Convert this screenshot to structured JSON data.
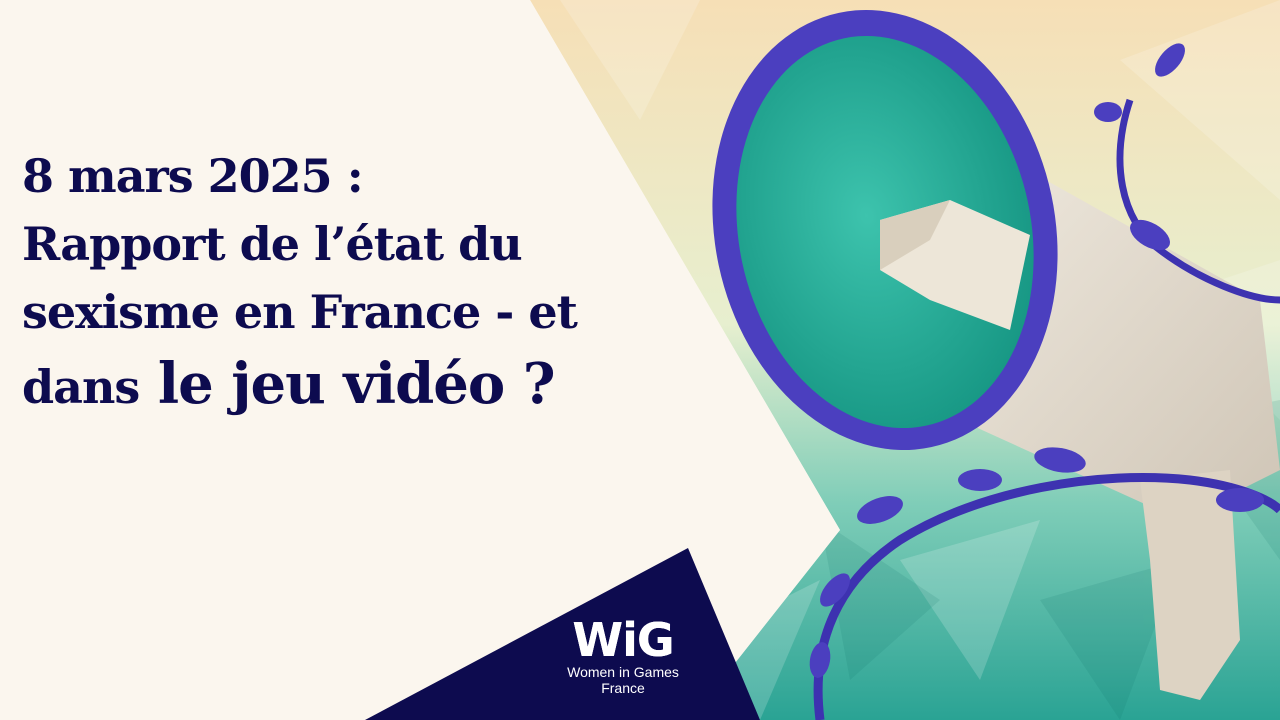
{
  "headline": {
    "line1": "8 mars 2025 :",
    "line2": "Rapport de l’état du",
    "line3": "sexisme en France - et",
    "line4_prefix": "dans",
    "line4_emphasis": "le jeu vidéo ?"
  },
  "logo": {
    "mark": "WiG",
    "name_line1": "Women in Games",
    "name_line2": "France"
  },
  "illustration": {
    "subject": "megaphone-icon",
    "colors": {
      "navy": "#0d0b4f",
      "violet": "#4b3fbf",
      "teal": "#27a596",
      "cream": "#fbf6ee",
      "peach": "#f6dfb6"
    }
  }
}
